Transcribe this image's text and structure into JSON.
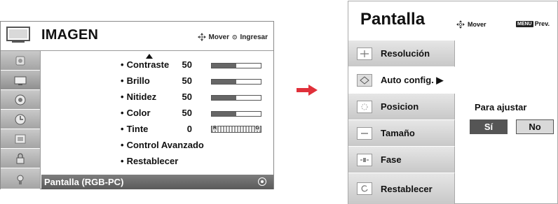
{
  "imagen_menu": {
    "title": "IMAGEN",
    "hint_move": "Mover",
    "hint_enter": "Ingresar",
    "side_icons": [
      "picture-icon",
      "screen-icon",
      "sound-icon",
      "time-icon",
      "option-icon",
      "lock-icon",
      "input-icon"
    ],
    "options": [
      {
        "label": "Contraste",
        "value": "50",
        "level": 0.5
      },
      {
        "label": "Brillo",
        "value": "50",
        "level": 0.5
      },
      {
        "label": "Nitidez",
        "value": "50",
        "level": 0.5
      },
      {
        "label": "Color",
        "value": "50",
        "level": 0.5
      },
      {
        "label": "Tinte",
        "value": "0",
        "tint_left": "R",
        "tint_right": "G"
      },
      {
        "label": "Control Avanzado"
      },
      {
        "label": "Restablecer"
      }
    ],
    "selected_item": "Pantalla (RGB-PC)"
  },
  "arrow_color": "#e0303a",
  "pantalla_menu": {
    "title": "Pantalla",
    "hint_move": "Mover",
    "hint_menu_key": "MENU",
    "hint_prev": "Prev.",
    "items": [
      {
        "label": "Resolución",
        "icon": "resolution-icon"
      },
      {
        "label": "Auto config. ▶",
        "icon": "auto-config-icon"
      },
      {
        "label": "Posicion",
        "icon": "position-icon"
      },
      {
        "label": "Tamaño",
        "icon": "size-icon"
      },
      {
        "label": "Fase",
        "icon": "phase-icon"
      },
      {
        "label": "Restablecer",
        "icon": "reset-icon"
      }
    ],
    "dialog": {
      "prompt": "Para ajustar",
      "yes": "Sí",
      "no": "No"
    }
  }
}
